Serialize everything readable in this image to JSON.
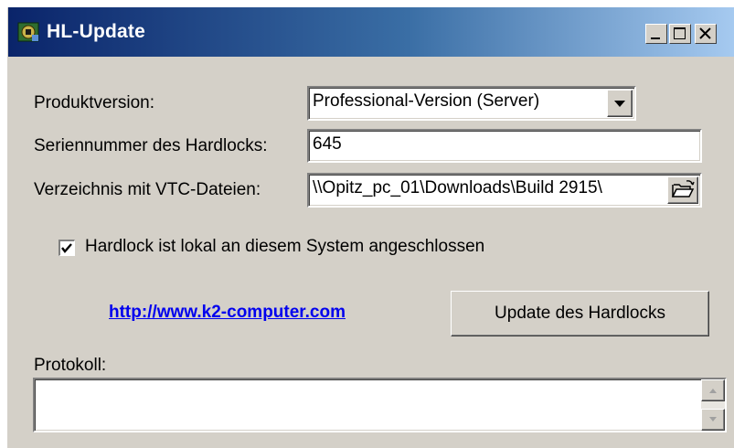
{
  "window": {
    "title": "HL-Update"
  },
  "form": {
    "product_version_label": "Produktversion:",
    "product_version_value": "Professional-Version (Server)",
    "serial_label": "Seriennummer des Hardlocks:",
    "serial_value": "645",
    "directory_label": "Verzeichnis mit VTC-Dateien:",
    "directory_value": "\\\\Opitz_pc_01\\Downloads\\Build 2915\\",
    "checkbox_label": "Hardlock ist lokal an diesem System angeschlossen",
    "checkbox_checked": true
  },
  "link": {
    "text": "http://www.k2-computer.com"
  },
  "update_button": {
    "label": "Update des Hardlocks"
  },
  "log": {
    "label": "Protokoll:",
    "value": ""
  },
  "icons": {
    "app": "app-icon",
    "minimize": "minimize-icon",
    "maximize": "maximize-icon",
    "close": "close-icon",
    "dropdown": "chevron-down-icon",
    "folder": "folder-open-icon",
    "check": "checkmark-icon",
    "scroll_up": "arrow-up-icon",
    "scroll_down": "arrow-down-icon"
  },
  "colors": {
    "titlebar_start": "#0a246a",
    "titlebar_end": "#a6caf0",
    "window_face": "#d4d0c8",
    "link": "#0000ee"
  }
}
